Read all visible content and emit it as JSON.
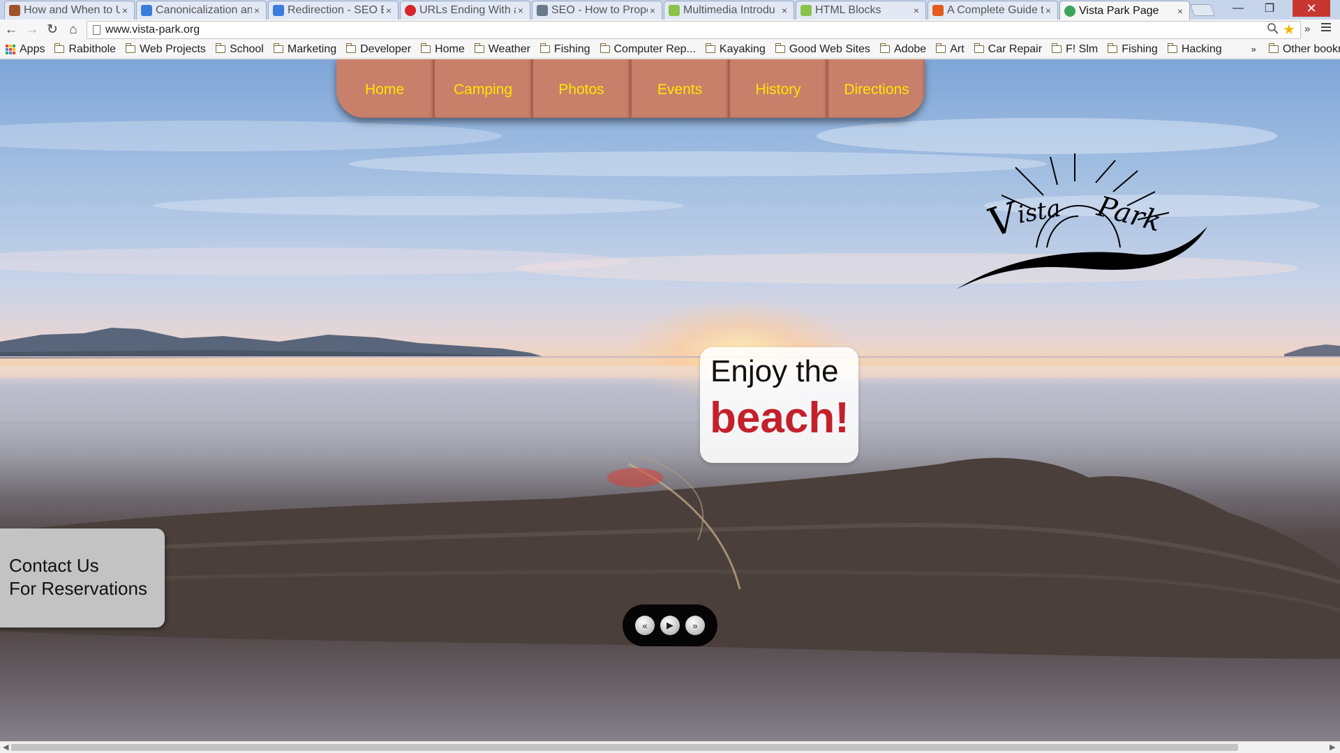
{
  "browser": {
    "tabs": [
      {
        "title": "How and When to U",
        "favicon_color": "#a0522d"
      },
      {
        "title": "Canonicalization an",
        "favicon_color": "#3b7ddd"
      },
      {
        "title": "Redirection - SEO E",
        "favicon_color": "#3b7ddd"
      },
      {
        "title": "URLs Ending With a",
        "favicon_color": "#d8232a"
      },
      {
        "title": "SEO - How to Prope",
        "favicon_color": "#6a7a8a"
      },
      {
        "title": "Multimedia Introdu",
        "favicon_color": "#8bc34a"
      },
      {
        "title": "HTML Blocks",
        "favicon_color": "#8bc34a"
      },
      {
        "title": "A Complete Guide t",
        "favicon_color": "#e25c1f"
      },
      {
        "title": "Vista Park Page",
        "favicon_color": "#3ba55c",
        "active": true
      }
    ],
    "tab_close": "×",
    "window_controls": {
      "minimize": "—",
      "maximize": "❐",
      "close": "✕"
    },
    "nav": {
      "back": "←",
      "forward": "→",
      "reload": "↻",
      "home": "⌂"
    },
    "url": "www.vista-park.org",
    "bookmarks": [
      "Rabithole",
      "Web Projects",
      "School",
      "Marketing",
      "Developer",
      "Home",
      "Weather",
      "Fishing",
      "Computer Rep...",
      "Kayaking",
      "Good Web Sites",
      "Adobe",
      "Art",
      "Car Repair",
      "F! Slm",
      "Fishing",
      "Hacking"
    ],
    "apps_label": "Apps",
    "overflow": "»",
    "other_bookmarks": "Other bookmarks"
  },
  "site": {
    "nav": [
      "Home",
      "Camping",
      "Photos",
      "Events",
      "History",
      "Directions"
    ],
    "logo_text": "Vista Park",
    "caption": {
      "line1": "Enjoy the",
      "line2": "beach!"
    },
    "contact": {
      "line1": "Contact Us",
      "line2": "For Reservations"
    },
    "slider": {
      "prev": "«",
      "play": "▶",
      "next": "»"
    },
    "colors": {
      "nav_bg": "#c9806a",
      "nav_text": "#ffe600",
      "caption_accent": "#c4202b"
    }
  }
}
